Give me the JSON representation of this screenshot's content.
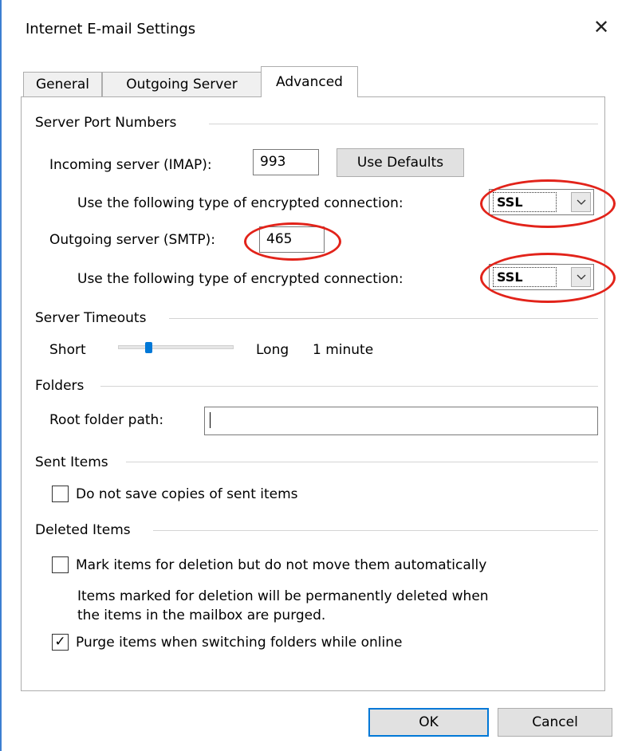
{
  "window": {
    "title": "Internet E-mail Settings",
    "close_glyph": "✕"
  },
  "tabs": [
    {
      "label": "General"
    },
    {
      "label": "Outgoing Server"
    },
    {
      "label": "Advanced",
      "active": true
    }
  ],
  "server_ports": {
    "group_label": "Server Port Numbers",
    "incoming_label": "Incoming server (IMAP):",
    "incoming_value": "993",
    "use_defaults_label": "Use Defaults",
    "encryption_label": "Use the following type of encrypted connection:",
    "incoming_encryption": "SSL",
    "outgoing_label": "Outgoing server (SMTP):",
    "outgoing_value": "465",
    "outgoing_encryption": "SSL",
    "dropdown_icon": "chevron-down-icon"
  },
  "timeouts": {
    "group_label": "Server Timeouts",
    "short_label": "Short",
    "long_label": "Long",
    "value_label": "1 minute",
    "slider_level_fraction": 0.25
  },
  "folders": {
    "group_label": "Folders",
    "root_label": "Root folder path:",
    "root_value": ""
  },
  "sent_items": {
    "group_label": "Sent Items",
    "no_copies_label": "Do not save copies of sent items",
    "no_copies_checked": false
  },
  "deleted_items": {
    "group_label": "Deleted Items",
    "mark_label": "Mark items for deletion but do not move them automatically",
    "mark_checked": false,
    "note_line1": "Items marked for deletion will be permanently deleted when",
    "note_line2": "the items in the mailbox are purged.",
    "purge_label": "Purge items when switching folders while online",
    "purge_checked": true,
    "check_glyph": "✓"
  },
  "footer": {
    "ok_label": "OK",
    "cancel_label": "Cancel"
  },
  "colors": {
    "highlight_ring": "#e2231a",
    "accent": "#0078d7"
  }
}
